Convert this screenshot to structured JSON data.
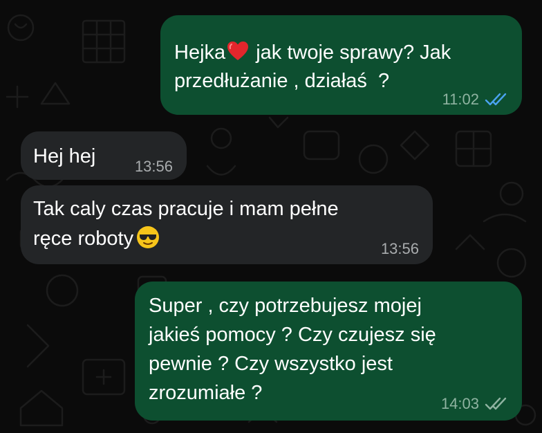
{
  "chat": {
    "messages": [
      {
        "direction": "outgoing",
        "text_part1": "Hejka",
        "emoji": "heart-icon",
        "text_part2": " jak twoje sprawy? Jak",
        "line2": "przedłużanie , działaś  ?",
        "time": "11:02",
        "status": "read",
        "ticks_color": "#4aa3f0"
      },
      {
        "direction": "incoming",
        "line1": "Hej hej",
        "time": "13:56"
      },
      {
        "direction": "incoming",
        "line1": "Tak caly czas pracuje i mam pełne",
        "line2": "ręce roboty",
        "emoji": "sunglasses-face-icon",
        "time": "13:56"
      },
      {
        "direction": "outgoing",
        "line1": "Super , czy potrzebujesz mojej",
        "line2": "jakieś pomocy ? Czy czujesz się",
        "line3": "pewnie ? Czy wszystko jest",
        "line4": "zrozumiałe ?",
        "time": "14:03",
        "status": "delivered",
        "ticks_color": "#8fb3a1"
      }
    ]
  },
  "colors": {
    "background": "#0b0b0b",
    "outgoing_bubble": "#0d4f30",
    "incoming_bubble": "#232527",
    "text": "#ffffff"
  }
}
